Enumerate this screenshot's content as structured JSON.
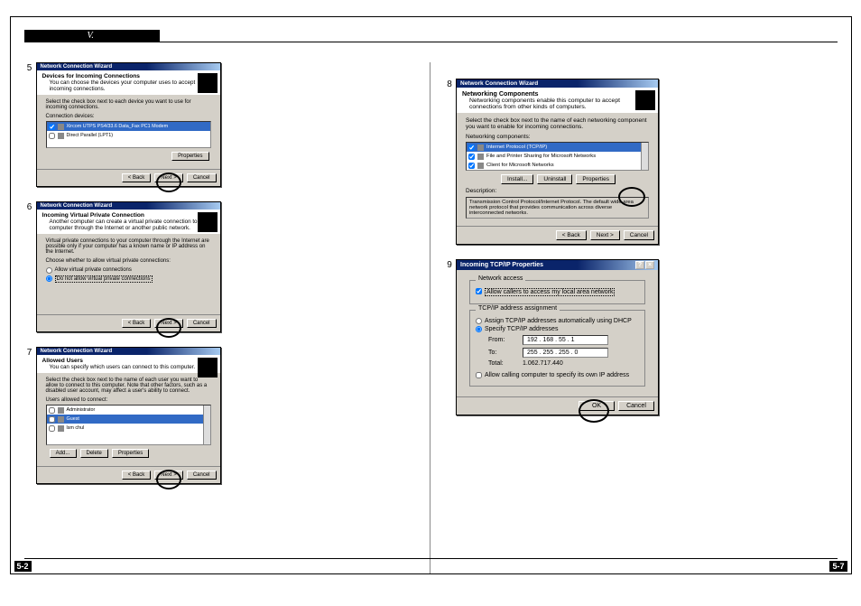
{
  "header": "V.",
  "page_left": "5-2",
  "page_right": "5-7",
  "step5": {
    "num": "5",
    "title": "Network Connection Wizard",
    "heading": "Devices for Incoming Connections",
    "subheading": "You can choose the devices your computer uses to accept incoming connections.",
    "instruction": "Select the check box next to each device you want to use for incoming connections.",
    "label": "Connection devices:",
    "item1": "Xircom UTPS PS4/33.6 Data_Fax PC1 Modem",
    "item2": "Direct Parallel (LPT1)",
    "btn_props": "Properties",
    "btn_back": "< Back",
    "btn_next": "Next >",
    "btn_cancel": "Cancel"
  },
  "step6": {
    "num": "6",
    "title": "Network Connection Wizard",
    "heading": "Incoming Virtual Private Connection",
    "subheading": "Another computer can create a virtual private connection to your computer through the Internet or another public network.",
    "instruction": "Virtual private connections to your computer through the Internet are possible only if your computer has a known name or IP address on the Internet.",
    "label": "Choose whether to allow virtual private connections:",
    "opt1": "Allow virtual private connections",
    "opt2": "Do not allow virtual private connections",
    "btn_back": "< Back",
    "btn_next": "Next >",
    "btn_cancel": "Cancel"
  },
  "step7": {
    "num": "7",
    "title": "Network Connection Wizard",
    "heading": "Allowed Users",
    "subheading": "You can specify which users can connect to this computer.",
    "instruction": "Select the check box next to the name of each user you want to allow to connect to this computer. Note that other factors, such as a disabled user account, may affect a user's ability to connect.",
    "label": "Users allowed to connect:",
    "user1": "Administrator",
    "user2": "Guest",
    "user3": "lsm chul",
    "btn_add": "Add...",
    "btn_delete": "Delete",
    "btn_props": "Properties",
    "btn_back": "< Back",
    "btn_next": "Next >",
    "btn_cancel": "Cancel"
  },
  "step8": {
    "num": "8",
    "title": "Network Connection Wizard",
    "heading": "Networking Components",
    "subheading": "Networking components enable this computer to accept connections from other kinds of computers.",
    "instruction": "Select the check box next to the name of each networking component you want to enable for incoming connections.",
    "label": "Networking components:",
    "comp1": "Internet Protocol (TCP/IP)",
    "comp2": "File and Printer Sharing for Microsoft Networks",
    "comp3": "Client for Microsoft Networks",
    "btn_install": "Install...",
    "btn_uninstall": "Uninstall",
    "btn_props": "Properties",
    "desc_label": "Description:",
    "desc": "Transmission Control Protocol/Internet Protocol. The default wide area network protocol that provides communication across diverse interconnected networks.",
    "btn_back": "< Back",
    "btn_next": "Next >",
    "btn_cancel": "Cancel"
  },
  "step9": {
    "num": "9",
    "title": "Incoming TCP/IP Properties",
    "group1": "Network access",
    "check1": "Allow callers to access my local area network",
    "group2": "TCP/IP address assignment",
    "opt1": "Assign TCP/IP addresses automatically using DHCP",
    "opt2": "Specify TCP/IP addresses",
    "from_label": "From:",
    "from_ip": "192 . 168 . 55 . 1",
    "to_label": "To:",
    "to_ip": "255 . 255 . 255 . 0",
    "total_label": "Total:",
    "total_val": "1.062.717.440",
    "check2": "Allow calling computer to specify its own IP address",
    "btn_ok": "OK",
    "btn_cancel": "Cancel"
  }
}
